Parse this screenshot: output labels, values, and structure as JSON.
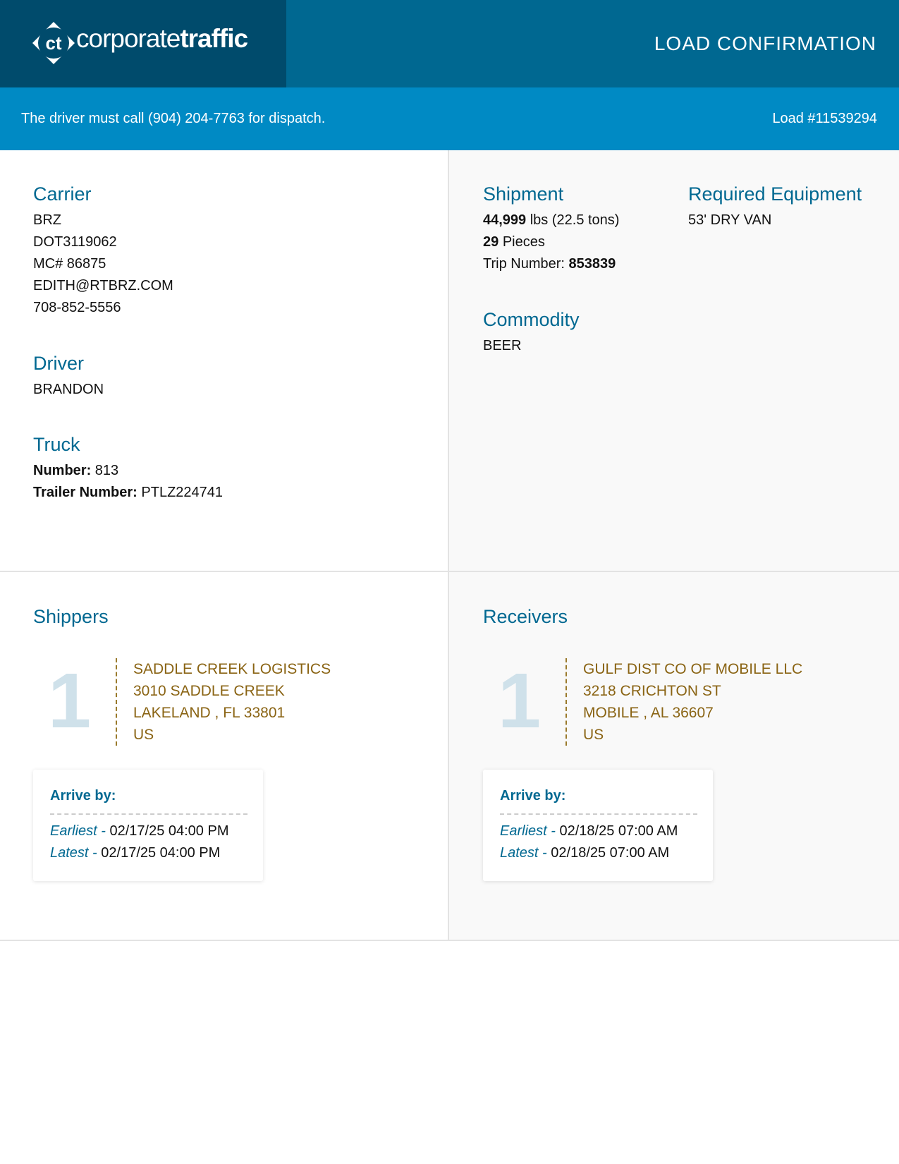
{
  "header": {
    "logo_part1": "corporate",
    "logo_part2": "traffic",
    "logo_mark": "ct",
    "title": "LOAD CONFIRMATION"
  },
  "subbar": {
    "dispatch_note": "The driver must call (904) 204-7763 for dispatch.",
    "load_number": "Load #11539294"
  },
  "carrier": {
    "heading": "Carrier",
    "lines": [
      "BRZ",
      "DOT3119062",
      "MC# 86875",
      "EDITH@RTBRZ.COM",
      "708-852-5556"
    ]
  },
  "driver": {
    "heading": "Driver",
    "name": "BRANDON"
  },
  "truck": {
    "heading": "Truck",
    "number_label": "Number:",
    "number": "813",
    "trailer_label": "Trailer Number:",
    "trailer": "PTLZ224741"
  },
  "shipment": {
    "heading": "Shipment",
    "weight": "44,999",
    "weight_suffix": "lbs (22.5 tons)",
    "pieces": "29",
    "pieces_suffix": "Pieces",
    "trip_label": "Trip Number:",
    "trip_number": "853839"
  },
  "equipment": {
    "heading": "Required Equipment",
    "value": "53' DRY VAN"
  },
  "commodity": {
    "heading": "Commodity",
    "value": "BEER"
  },
  "shippers": {
    "heading": "Shippers",
    "stop_number": "1",
    "address": [
      "SADDLE CREEK LOGISTICS",
      "3010 SADDLE CREEK",
      "LAKELAND , FL 33801",
      "US"
    ],
    "arrive_label": "Arrive by:",
    "earliest_label": "Earliest -",
    "earliest": "02/17/25 04:00 PM",
    "latest_label": "Latest -",
    "latest": "02/17/25 04:00 PM"
  },
  "receivers": {
    "heading": "Receivers",
    "stop_number": "1",
    "address": [
      "GULF DIST CO OF MOBILE LLC",
      "3218 CRICHTON ST",
      "MOBILE , AL 36607",
      "US"
    ],
    "arrive_label": "Arrive by:",
    "earliest_label": "Earliest -",
    "earliest": "02/18/25 07:00 AM",
    "latest_label": "Latest -",
    "latest": "02/18/25 07:00 AM"
  },
  "colors": {
    "header_dark": "#004b6c",
    "header": "#006891",
    "subbar": "#008ac4",
    "heading": "#006891",
    "address": "#8a6414"
  }
}
